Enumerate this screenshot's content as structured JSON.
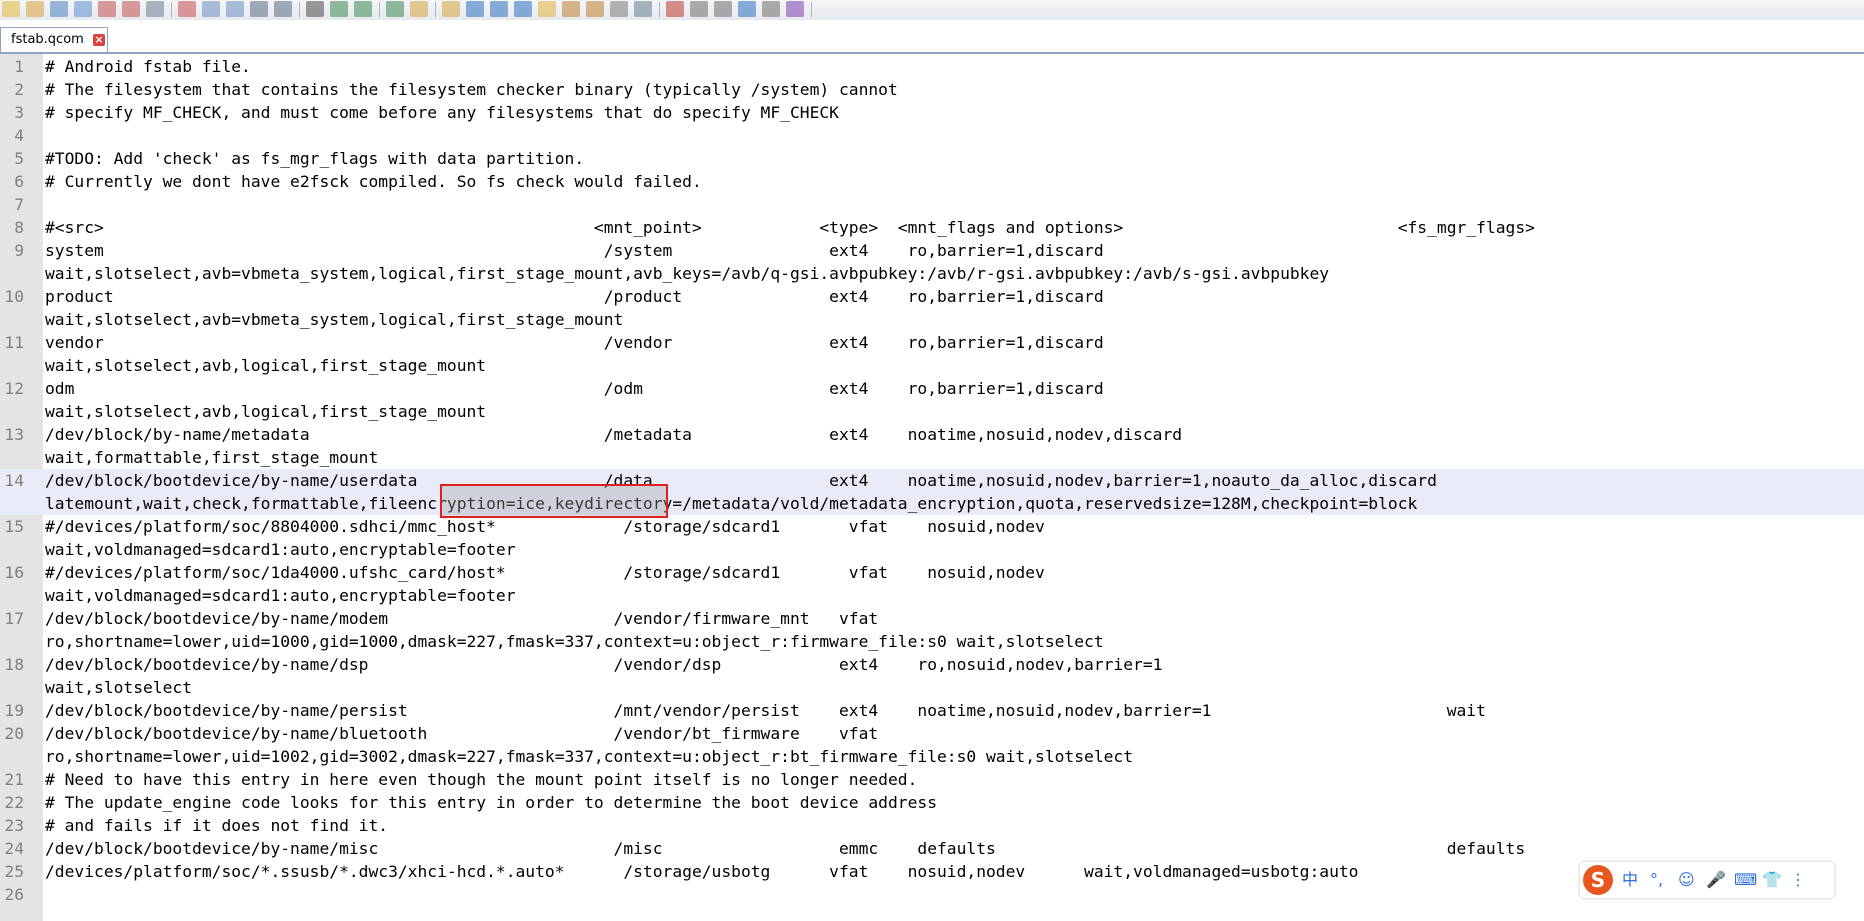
{
  "tab": {
    "title": "fstab.qcom",
    "close_glyph": "×"
  },
  "toolbar": {
    "icons": [
      "new-file-icon",
      "open-file-icon",
      "save-icon",
      "save-all-icon",
      "close-icon",
      "close-all-icon",
      "print-icon",
      "cut-icon",
      "copy-icon",
      "paste-icon",
      "undo-icon",
      "redo-icon",
      "find-icon",
      "replace-icon",
      "zoom-in-icon",
      "zoom-out-icon",
      "sync-vertical-icon",
      "sync-horizontal-icon",
      "word-wrap-icon",
      "show-all-chars-icon",
      "indent-guide-icon",
      "bookmark-icon",
      "function-list-icon",
      "folder-tree-icon",
      "document-map-icon",
      "monitor-icon",
      "record-macro-icon",
      "stop-macro-icon",
      "play-macro-icon",
      "run-macro-multiple-icon",
      "save-macro-icon",
      "spellcheck-icon"
    ]
  },
  "editor": {
    "highlighted_line": 14,
    "lines": [
      {
        "n": "1",
        "text": "# Android fstab file."
      },
      {
        "n": "2",
        "text": "# The filesystem that contains the filesystem checker binary (typically /system) cannot"
      },
      {
        "n": "3",
        "text": "# specify MF_CHECK, and must come before any filesystems that do specify MF_CHECK"
      },
      {
        "n": "4",
        "text": ""
      },
      {
        "n": "5",
        "text": "#TODO: Add 'check' as fs_mgr_flags with data partition."
      },
      {
        "n": "6",
        "text": "# Currently we dont have e2fsck compiled. So fs check would failed."
      },
      {
        "n": "7",
        "text": ""
      },
      {
        "n": "8",
        "text": "#<src>                                                  <mnt_point>            <type>  <mnt_flags and options>                            <fs_mgr_flags>"
      },
      {
        "n": "9",
        "text": "system                                                   /system                ext4    ro,barrier=1,discard"
      },
      {
        "n": "",
        "text": "wait,slotselect,avb=vbmeta_system,logical,first_stage_mount,avb_keys=/avb/q-gsi.avbpubkey:/avb/r-gsi.avbpubkey:/avb/s-gsi.avbpubkey"
      },
      {
        "n": "10",
        "text": "product                                                  /product               ext4    ro,barrier=1,discard"
      },
      {
        "n": "",
        "text": "wait,slotselect,avb=vbmeta_system,logical,first_stage_mount"
      },
      {
        "n": "11",
        "text": "vendor                                                   /vendor                ext4    ro,barrier=1,discard"
      },
      {
        "n": "",
        "text": "wait,slotselect,avb,logical,first_stage_mount"
      },
      {
        "n": "12",
        "text": "odm                                                      /odm                   ext4    ro,barrier=1,discard"
      },
      {
        "n": "",
        "text": "wait,slotselect,avb,logical,first_stage_mount"
      },
      {
        "n": "13",
        "text": "/dev/block/by-name/metadata                              /metadata              ext4    noatime,nosuid,nodev,discard"
      },
      {
        "n": "",
        "text": "wait,formattable,first_stage_mount"
      },
      {
        "n": "14",
        "text": "/dev/block/bootdevice/by-name/userdata                   /data                  ext4    noatime,nosuid,nodev,barrier=1,noauto_da_alloc,discard"
      },
      {
        "n": "",
        "text": "latemount,wait,check,formattable,fileencryption=ice,keydirectory=/metadata/vold/metadata_encryption,quota,reservedsize=128M,checkpoint=block"
      },
      {
        "n": "15",
        "text": "#/devices/platform/soc/8804000.sdhci/mmc_host*             /storage/sdcard1       vfat    nosuid,nodev"
      },
      {
        "n": "",
        "text": "wait,voldmanaged=sdcard1:auto,encryptable=footer"
      },
      {
        "n": "16",
        "text": "#/devices/platform/soc/1da4000.ufshc_card/host*            /storage/sdcard1       vfat    nosuid,nodev"
      },
      {
        "n": "",
        "text": "wait,voldmanaged=sdcard1:auto,encryptable=footer"
      },
      {
        "n": "17",
        "text": "/dev/block/bootdevice/by-name/modem                       /vendor/firmware_mnt   vfat"
      },
      {
        "n": "",
        "text": "ro,shortname=lower,uid=1000,gid=1000,dmask=227,fmask=337,context=u:object_r:firmware_file:s0 wait,slotselect"
      },
      {
        "n": "18",
        "text": "/dev/block/bootdevice/by-name/dsp                         /vendor/dsp            ext4    ro,nosuid,nodev,barrier=1"
      },
      {
        "n": "",
        "text": "wait,slotselect"
      },
      {
        "n": "19",
        "text": "/dev/block/bootdevice/by-name/persist                     /mnt/vendor/persist    ext4    noatime,nosuid,nodev,barrier=1                        wait"
      },
      {
        "n": "20",
        "text": "/dev/block/bootdevice/by-name/bluetooth                   /vendor/bt_firmware    vfat"
      },
      {
        "n": "",
        "text": "ro,shortname=lower,uid=1002,gid=3002,dmask=227,fmask=337,context=u:object_r:bt_firmware_file:s0 wait,slotselect"
      },
      {
        "n": "21",
        "text": "# Need to have this entry in here even though the mount point itself is no longer needed."
      },
      {
        "n": "22",
        "text": "# The update_engine code looks for this entry in order to determine the boot device address"
      },
      {
        "n": "23",
        "text": "# and fails if it does not find it."
      },
      {
        "n": "24",
        "text": "/dev/block/bootdevice/by-name/misc                        /misc                  emmc    defaults                                              defaults"
      },
      {
        "n": "25",
        "text": "/devices/platform/soc/*.ssusb/*.dwc3/xhci-hcd.*.auto*      /storage/usbotg      vfat    nosuid,nodev      wait,voldmanaged=usbotg:auto"
      },
      {
        "n": "26",
        "text": ""
      }
    ]
  },
  "ime_bar": {
    "logo": "S",
    "items": [
      "中",
      "°,",
      "☺",
      "🎤",
      "⌨",
      "👕",
      "⋮"
    ]
  }
}
